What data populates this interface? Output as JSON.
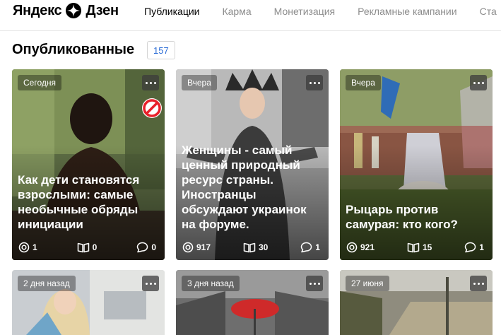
{
  "header": {
    "logo_left": "Яндекс",
    "logo_right": "Дзен",
    "tabs": [
      {
        "label": "Публикации",
        "active": true
      },
      {
        "label": "Карма",
        "active": false
      },
      {
        "label": "Монетизация",
        "active": false
      },
      {
        "label": "Рекламные кампании",
        "active": false
      },
      {
        "label": "Ста",
        "active": false
      }
    ]
  },
  "main": {
    "heading": "Опубликованные",
    "count": "157",
    "cards": [
      {
        "date": "Сегодня",
        "title": "Как дети становятся взрослыми: самые необычные обряды инициации",
        "views": "1",
        "reads": "0",
        "comments": "0",
        "blocked": true
      },
      {
        "date": "Вчера",
        "title": "Женщины - самый ценный природный ресурс страны. Иностранцы обсуждают украинок на форуме.",
        "views": "917",
        "reads": "30",
        "comments": "1",
        "blocked": false
      },
      {
        "date": "Вчера",
        "title": "Рыцарь против самурая: кто кого?",
        "views": "921",
        "reads": "15",
        "comments": "1",
        "blocked": false
      },
      {
        "date": "2 дня назад"
      },
      {
        "date": "3 дня назад"
      },
      {
        "date": "27 июня"
      }
    ]
  },
  "colors": {
    "accent": "#2b6cd6",
    "blocked": "#e8202a",
    "muted_text": "#8c8c8c"
  },
  "icons": {
    "logo": "dzen-star-icon",
    "menu": "more-dots-icon",
    "views": "eye-icon",
    "reads": "book-icon",
    "comments": "comment-icon",
    "blocked": "blocked-icon"
  }
}
